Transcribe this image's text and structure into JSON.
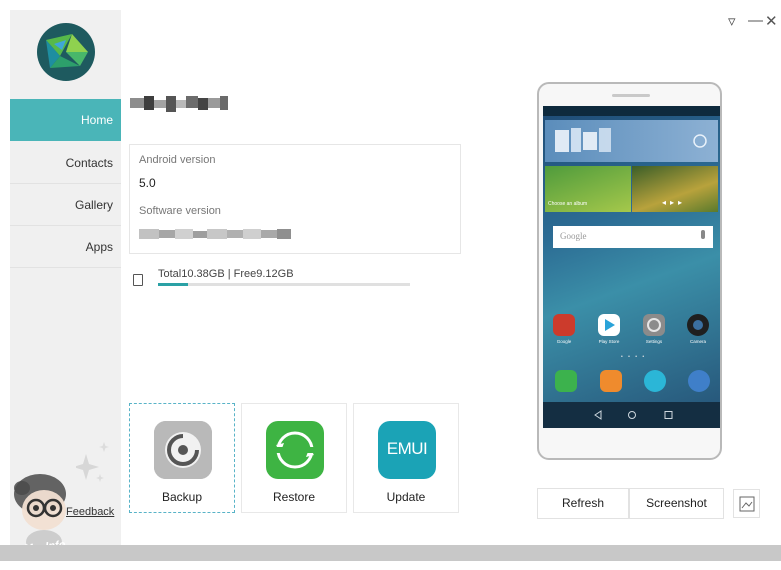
{
  "sidebar": {
    "items": [
      {
        "label": "Home"
      },
      {
        "label": "Contacts"
      },
      {
        "label": "Gallery"
      },
      {
        "label": "Apps"
      }
    ],
    "feedback_label": "Feedback"
  },
  "watermark_text": "Ms. Info",
  "window_controls": {
    "menu_icon": "▿",
    "minimize_icon": "—",
    "close_icon": "✕"
  },
  "device_info": {
    "android_label": "Android version",
    "android_value": "5.0",
    "software_label": "Software version"
  },
  "storage": {
    "text": "Total10.38GB | Free9.12GB",
    "used_fraction": 0.12
  },
  "actions": [
    {
      "label": "Backup"
    },
    {
      "label": "Restore"
    },
    {
      "label": "Update",
      "icon_text": "EMUI"
    }
  ],
  "phone_screen": {
    "search_placeholder": "Google",
    "music_caption": "Choose an album",
    "app_labels": [
      "Google",
      "Play Store",
      "Settings",
      "Camera"
    ]
  },
  "buttons": {
    "refresh": "Refresh",
    "screenshot": "Screenshot"
  },
  "colors": {
    "accent": "#4ab5b8",
    "progress": "#2aa1a5",
    "restore_green": "#3eb443",
    "update_teal": "#1ba3b6"
  }
}
